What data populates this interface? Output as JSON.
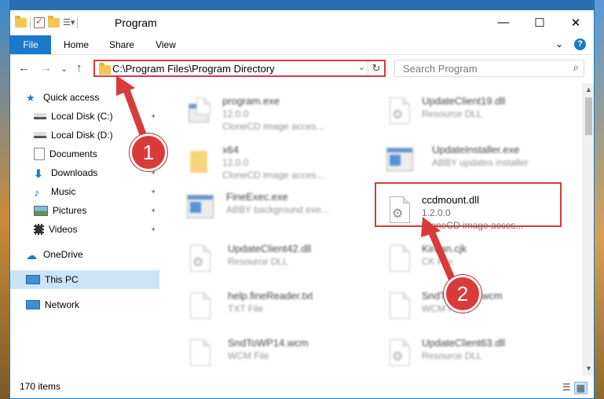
{
  "window": {
    "title": "Program",
    "caption": {
      "minimize": "—",
      "maximize": "☐",
      "close": "✕"
    }
  },
  "ribbon": {
    "tabs": [
      "File",
      "Home",
      "Share",
      "View"
    ],
    "expand": "⌄",
    "help": "?"
  },
  "nav": {
    "back": "←",
    "forward": "→",
    "recent": "⌄",
    "up": "↑",
    "address": "C:\\Program Files\\Program Directory",
    "address_dropdown": "⌄",
    "refresh": "↻",
    "search_placeholder": "Search Program",
    "search_icon": "⌕"
  },
  "sidebar": {
    "items": [
      {
        "label": "Quick access",
        "icon": "star-icon",
        "pinned": false
      },
      {
        "label": "Local Disk (C:)",
        "icon": "drive-icon",
        "pinned": true
      },
      {
        "label": "Local Disk (D:)",
        "icon": "drive-icon",
        "pinned": true
      },
      {
        "label": "Documents",
        "icon": "documents-icon",
        "pinned": true
      },
      {
        "label": "Downloads",
        "icon": "download-icon",
        "pinned": true
      },
      {
        "label": "Music",
        "icon": "music-icon",
        "pinned": true
      },
      {
        "label": "Pictures",
        "icon": "pictures-icon",
        "pinned": true
      },
      {
        "label": "Videos",
        "icon": "videos-icon",
        "pinned": true
      },
      {
        "label": "OneDrive",
        "icon": "cloud-icon",
        "pinned": false
      },
      {
        "label": "This PC",
        "icon": "computer-icon",
        "pinned": false,
        "selected": true
      },
      {
        "label": "Network",
        "icon": "network-icon",
        "pinned": false
      }
    ],
    "pin_glyph": "📌"
  },
  "files": [
    {
      "name": "program.exe",
      "type": "12.0.0",
      "desc": "CloneCD image acces...",
      "kind": "exe-setup"
    },
    {
      "name": "UpdateClient19.dll",
      "type": "Resource DLL",
      "desc": "",
      "kind": "dll"
    },
    {
      "name": "x64",
      "type": "12.0.0",
      "desc": "CloneCD image acces...",
      "kind": "folder"
    },
    {
      "name": "UpdateInstaller.exe",
      "type": "ABBY updates installer",
      "desc": "",
      "kind": "exe"
    },
    {
      "name": "FineExec.exe",
      "type": "ABBY background exe...",
      "desc": "",
      "kind": "exe"
    },
    {
      "name": "ccdmount.dll",
      "type": "1.2.0.0",
      "desc": "CloneCD image acces...",
      "kind": "dll",
      "highlighted": true
    },
    {
      "name": "UpdateClient42.dll",
      "type": "Resource DLL",
      "desc": "",
      "kind": "dll"
    },
    {
      "name": "Kirean.cjk",
      "type": "CK File",
      "desc": "",
      "kind": "doc"
    },
    {
      "name": "help.fineReader.txt",
      "type": "TXT File",
      "desc": "",
      "kind": "doc"
    },
    {
      "name": "SndToWP13.wcm",
      "type": "WCM File",
      "desc": "",
      "kind": "doc"
    },
    {
      "name": "SndToWP14.wcm",
      "type": "WCM File",
      "desc": "",
      "kind": "doc"
    },
    {
      "name": "UpdateClient63.dll",
      "type": "Resource DLL",
      "desc": "",
      "kind": "dll"
    }
  ],
  "status": {
    "count": "170 items"
  },
  "annotations": {
    "step1": "1",
    "step2": "2",
    "accent": "#d93a3a"
  }
}
